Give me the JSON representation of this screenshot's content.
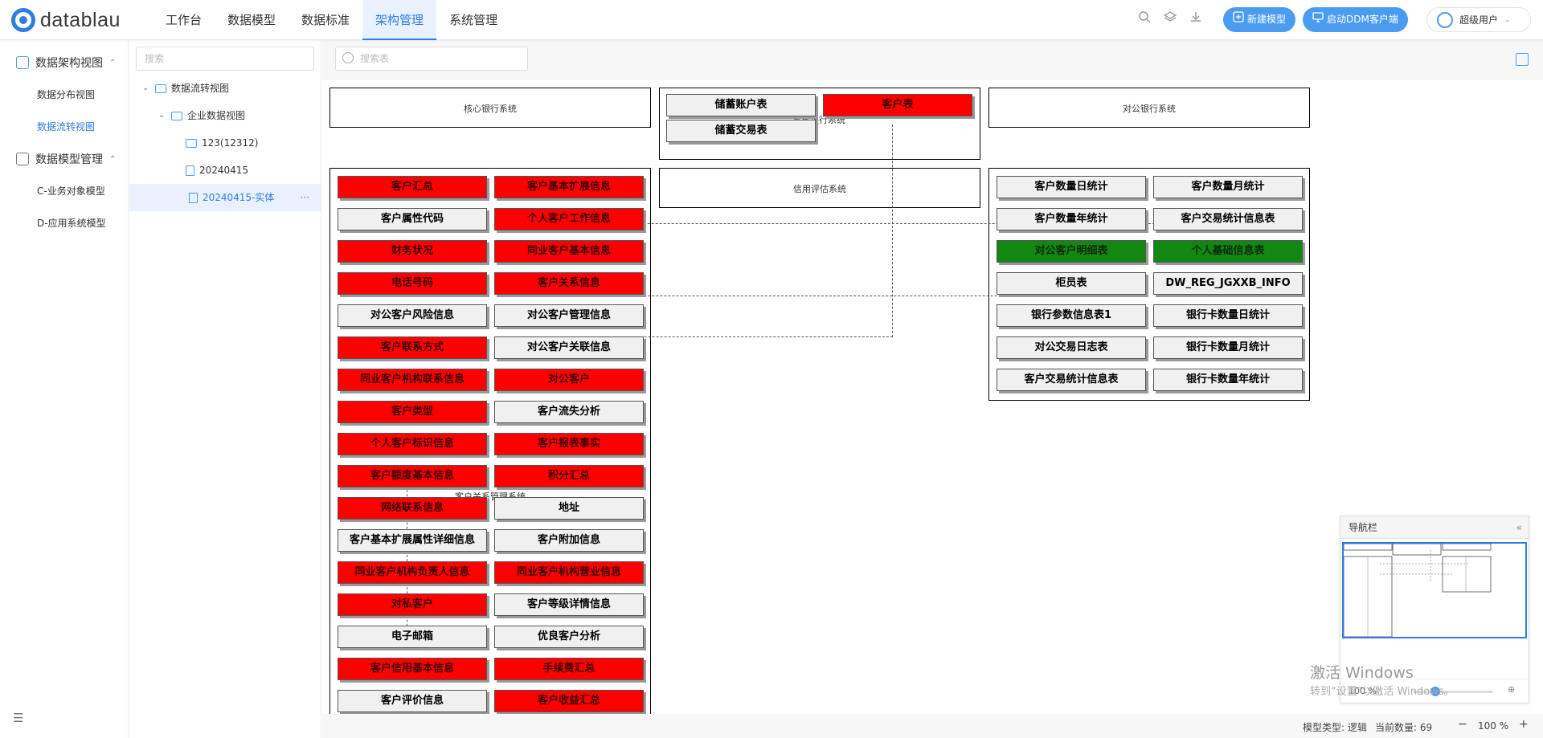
{
  "app": {
    "logo_text": "datablau"
  },
  "nav": [
    "工作台",
    "数据模型",
    "数据标准",
    "架构管理",
    "系统管理"
  ],
  "header": {
    "new_model": "新建模型",
    "launch_ddm": "启动DDM客户端",
    "user": "超级用户",
    "icons": [
      "search-icon",
      "layers-icon",
      "download-icon"
    ]
  },
  "sidebar": {
    "group1": "数据架构视图",
    "items1": [
      "数据分布视图",
      "数据流转视图"
    ],
    "group2": "数据模型管理",
    "items2": [
      "C-业务对象模型",
      "D-应用系统模型"
    ]
  },
  "tree": {
    "search_placeholder": "搜索",
    "nodes": [
      "数据流转视图",
      "企业数据视图",
      "123(12312)",
      "20240415",
      "20240415-实体"
    ],
    "more": "···"
  },
  "main": {
    "search_placeholder": "搜索表"
  },
  "diagram": {
    "systems": {
      "core": "核心银行系统",
      "retail": "零售银行系统",
      "corporate": "对公银行系统",
      "credit": "信用评估系统",
      "crm": "客户关系管理系统"
    },
    "retail_entities": [
      {
        "name": "储蓄账户表",
        "color": "grey"
      },
      {
        "name": "客户表",
        "color": "red"
      },
      {
        "name": "储蓄交易表",
        "color": "grey"
      }
    ],
    "crm_left": [
      {
        "name": "客户汇总",
        "color": "red"
      },
      {
        "name": "客户属性代码",
        "color": "grey"
      },
      {
        "name": "财务状况",
        "color": "red"
      },
      {
        "name": "电话号码",
        "color": "red"
      },
      {
        "name": "对公客户风险信息",
        "color": "grey"
      },
      {
        "name": "客户联系方式",
        "color": "red"
      },
      {
        "name": "同业客户机构联系信息",
        "color": "red"
      },
      {
        "name": "客户类型",
        "color": "red"
      },
      {
        "name": "个人客户标识信息",
        "color": "red"
      },
      {
        "name": "客户额度基本信息",
        "color": "red"
      },
      {
        "name": "网络联系信息",
        "color": "red"
      },
      {
        "name": "客户基本扩展属性详细信息",
        "color": "grey"
      },
      {
        "name": "同业客户机构负责人信息",
        "color": "red"
      },
      {
        "name": "对私客户",
        "color": "red"
      },
      {
        "name": "电子邮箱",
        "color": "grey"
      },
      {
        "name": "客户信用基本信息",
        "color": "red"
      },
      {
        "name": "客户评价信息",
        "color": "grey"
      }
    ],
    "crm_right": [
      {
        "name": "客户基本扩展信息",
        "color": "red"
      },
      {
        "name": "个人客户工作信息",
        "color": "red"
      },
      {
        "name": "同业客户基本信息",
        "color": "red"
      },
      {
        "name": "客户关系信息",
        "color": "red"
      },
      {
        "name": "对公客户管理信息",
        "color": "grey"
      },
      {
        "name": "对公客户关联信息",
        "color": "grey"
      },
      {
        "name": "对公客户",
        "color": "red"
      },
      {
        "name": "客户流失分析",
        "color": "grey"
      },
      {
        "name": "客户报表事实",
        "color": "red"
      },
      {
        "name": "积分汇总",
        "color": "red"
      },
      {
        "name": "地址",
        "color": "grey"
      },
      {
        "name": "客户附加信息",
        "color": "grey"
      },
      {
        "name": "同业客户机构营业信息",
        "color": "red"
      },
      {
        "name": "客户等级详情信息",
        "color": "grey"
      },
      {
        "name": "优良客户分析",
        "color": "grey"
      },
      {
        "name": "手续费汇总",
        "color": "red"
      },
      {
        "name": "客户收益汇总",
        "color": "red"
      }
    ],
    "dw_left": [
      {
        "name": "客户数量日统计",
        "color": "grey"
      },
      {
        "name": "客户数量年统计",
        "color": "grey"
      },
      {
        "name": "对公客户明细表",
        "color": "green"
      },
      {
        "name": "柜员表",
        "color": "grey"
      },
      {
        "name": "银行参数信息表1",
        "color": "grey"
      },
      {
        "name": "对公交易日志表",
        "color": "grey"
      },
      {
        "name": "客户交易统计信息表",
        "color": "grey"
      }
    ],
    "dw_right": [
      {
        "name": "客户数量月统计",
        "color": "grey"
      },
      {
        "name": "客户交易统计信息表",
        "color": "grey"
      },
      {
        "name": "个人基础信息表",
        "color": "green"
      },
      {
        "name": "DW_REG_JGXXB_INFO",
        "color": "grey"
      },
      {
        "name": "银行卡数量日统计",
        "color": "grey"
      },
      {
        "name": "银行卡数量月统计",
        "color": "grey"
      },
      {
        "name": "银行卡数量年统计",
        "color": "grey"
      }
    ]
  },
  "navigator": {
    "title": "导航栏",
    "zoom": "100 %"
  },
  "status": {
    "model_type": "模型类型: 逻辑",
    "count": "当前数量: 69",
    "zoom": "100 %",
    "minus": "−",
    "plus": "+"
  },
  "watermark": {
    "line1": "激活 Windows",
    "line2": "转到“设置”以激活 Windows。"
  }
}
